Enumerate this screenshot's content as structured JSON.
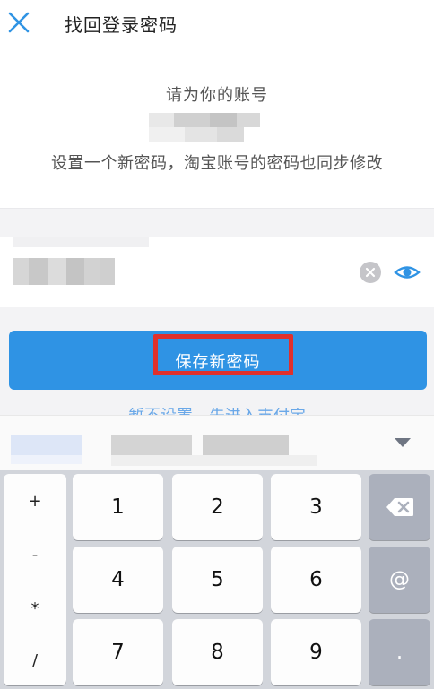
{
  "header": {
    "title": "找回登录密码",
    "close_icon": "close-icon"
  },
  "intro": {
    "line1": "请为你的账号",
    "line3": "设置一个新密码，淘宝账号的密码也同步修改"
  },
  "password_field": {
    "clear_icon": "clear-icon",
    "visibility_icon": "eye-icon"
  },
  "save_button": {
    "label": "保存新密码"
  },
  "secondary_link": {
    "label": "暂不设置，先进入支付宝"
  },
  "suggestion_bar": {
    "collapse_icon": "chevron-down-icon"
  },
  "keyboard": {
    "symbols": [
      "+",
      "-",
      "*",
      "/"
    ],
    "digits": [
      "1",
      "2",
      "3",
      "4",
      "5",
      "6",
      "7",
      "8",
      "9"
    ],
    "at": "@",
    "dot": ".",
    "backspace_icon": "backspace-icon"
  },
  "colors": {
    "accent": "#2f93e4",
    "highlight": "#e0302c",
    "keyboard_bg": "#d2d5db"
  }
}
